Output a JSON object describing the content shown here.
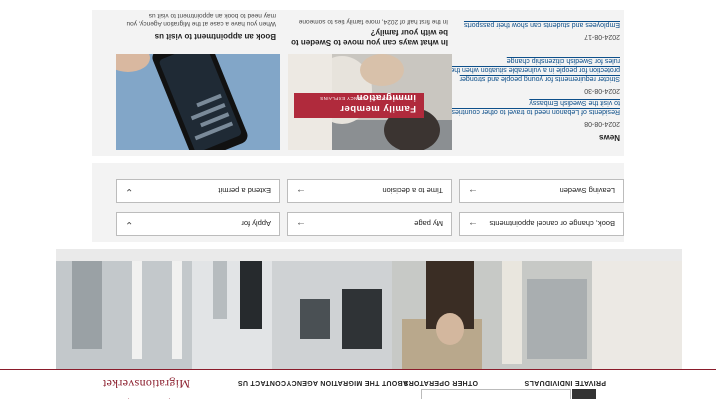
{
  "header": {
    "logo": "Migrationsverket",
    "nav": [
      "PRIVATE INDIVIDUALS",
      "OTHER OPERATORS",
      "ABOUT THE MIGRATION AGENCY",
      "CONTACT US"
    ]
  },
  "quick_links": [
    {
      "label": "Apply for",
      "icon": "chevron-down-icon"
    },
    {
      "label": "My page",
      "icon": "arrow-right-icon"
    },
    {
      "label": "Book, change or cancel appointments",
      "icon": "arrow-right-icon"
    },
    {
      "label": "Extend a permit",
      "icon": "chevron-down-icon"
    },
    {
      "label": "Time to a decision",
      "icon": "arrow-right-icon"
    },
    {
      "label": "Leaving Sweden",
      "icon": "arrow-right-icon"
    }
  ],
  "news": {
    "title": "News",
    "items": [
      {
        "date": "2024-08-08",
        "text": "Residents of Lebanon need to travel to other countries to visit the Swedish Embassy"
      },
      {
        "date": "2024-08-30",
        "text": "Stricter requirements for young people and stronger protection for people in a vulnerable situation when the rules for Swedish citizenship change"
      },
      {
        "date": "2024-08-17",
        "text": "Employees and students can show their passports"
      }
    ]
  },
  "cards": [
    {
      "title": "In what ways can you move to Sweden to be with your family?",
      "text": "In the first half of 2024, more family ties to someone",
      "banner_title": "Family member immigration",
      "banner_sub": "THE MIGRATION AGENCY EXPLAINS"
    },
    {
      "title": "Book an appointment to visit us",
      "text": "When you have a case at the Migration Agency, you may need to book an appointment to visit us"
    }
  ]
}
